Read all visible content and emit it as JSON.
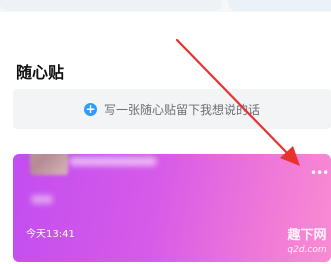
{
  "section": {
    "title": "随心贴"
  },
  "compose": {
    "icon": "plus-circle-icon",
    "prompt": "写一张随心贴留下我想说的话"
  },
  "note": {
    "timestamp": "今天13:41",
    "more_icon": "more-icon",
    "gradient_start": "#c34df0",
    "gradient_end": "#f98cd3"
  },
  "watermark": {
    "brand": "趣下网",
    "domain": "q2d.com"
  },
  "annotation": {
    "arrow_color": "#e8322f"
  },
  "colors": {
    "accent_blue": "#2e9bff"
  }
}
